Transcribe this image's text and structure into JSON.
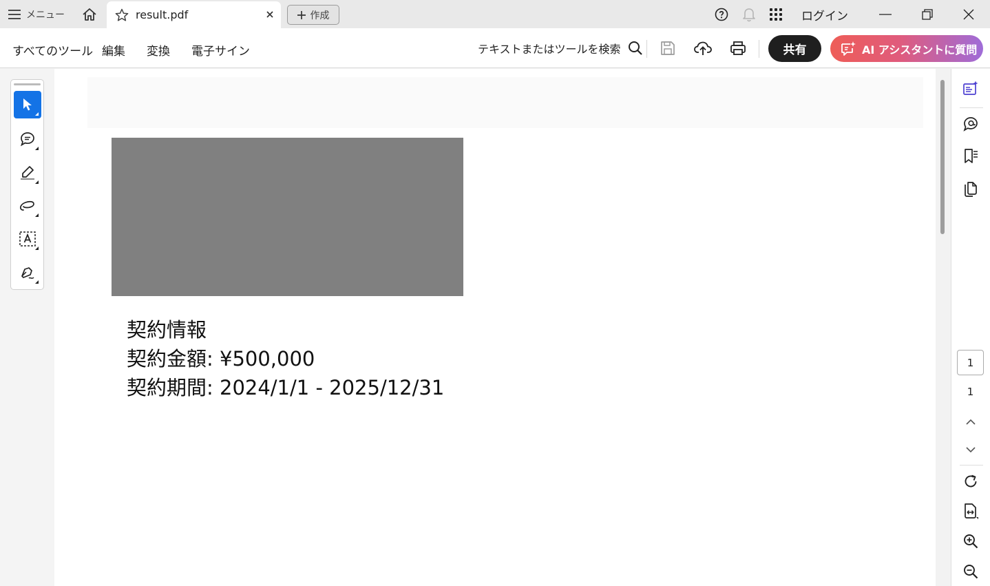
{
  "titlebar": {
    "menu_label": "メニュー",
    "tab_title": "result.pdf",
    "create_label": "作成",
    "login_label": "ログイン"
  },
  "toolbar": {
    "nav": [
      "すべてのツール",
      "編集",
      "変換",
      "電子サイン"
    ],
    "search_label": "テキストまたはツールを検索",
    "share_label": "共有",
    "ai_label": "AI アシスタントに質問"
  },
  "document": {
    "lines": [
      "契約情報",
      "契約金額: ¥500,000",
      "契約期間: 2024/1/1 - 2025/12/31"
    ]
  },
  "pagination": {
    "current_page": "1",
    "total_pages": "1"
  },
  "icons": {
    "left_tools": [
      "select-icon",
      "comment-icon",
      "highlight-icon",
      "draw-icon",
      "text-select-icon",
      "sign-icon"
    ],
    "right_rail": [
      "ai-summary-icon",
      "comments-panel-icon",
      "bookmarks-icon",
      "pages-icon",
      "rotate-icon",
      "fit-width-icon",
      "zoom-in-icon",
      "zoom-out-icon"
    ]
  },
  "colors": {
    "accent": "#1473e6",
    "share_bg": "#1f1f1f",
    "ai_gradient_start": "#ee5d57",
    "ai_gradient_end": "#9f6cd8",
    "image_placeholder": "#808080"
  }
}
